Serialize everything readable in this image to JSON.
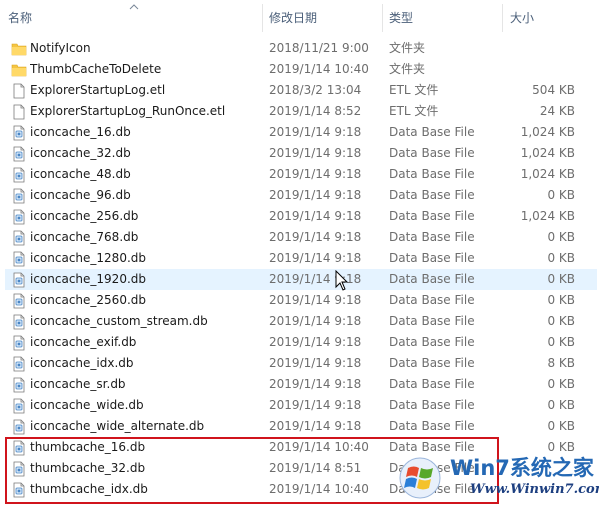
{
  "columns": {
    "name": "名称",
    "date": "修改日期",
    "type": "类型",
    "size": "大小"
  },
  "files": [
    {
      "name": "NotifyIcon",
      "date": "2018/11/21 9:00",
      "type": "文件夹",
      "size": "",
      "icon": "folder-icon"
    },
    {
      "name": "ThumbCacheToDelete",
      "date": "2019/1/14 10:40",
      "type": "文件夹",
      "size": "",
      "icon": "folder-icon"
    },
    {
      "name": "ExplorerStartupLog.etl",
      "date": "2018/3/2 13:04",
      "type": "ETL 文件",
      "size": "504 KB",
      "icon": "file-icon"
    },
    {
      "name": "ExplorerStartupLog_RunOnce.etl",
      "date": "2019/1/14 8:52",
      "type": "ETL 文件",
      "size": "24 KB",
      "icon": "file-icon"
    },
    {
      "name": "iconcache_16.db",
      "date": "2019/1/14 9:18",
      "type": "Data Base File",
      "size": "1,024 KB",
      "icon": "db-file-icon"
    },
    {
      "name": "iconcache_32.db",
      "date": "2019/1/14 9:18",
      "type": "Data Base File",
      "size": "1,024 KB",
      "icon": "db-file-icon"
    },
    {
      "name": "iconcache_48.db",
      "date": "2019/1/14 9:18",
      "type": "Data Base File",
      "size": "1,024 KB",
      "icon": "db-file-icon"
    },
    {
      "name": "iconcache_96.db",
      "date": "2019/1/14 9:18",
      "type": "Data Base File",
      "size": "0 KB",
      "icon": "db-file-icon"
    },
    {
      "name": "iconcache_256.db",
      "date": "2019/1/14 9:18",
      "type": "Data Base File",
      "size": "1,024 KB",
      "icon": "db-file-icon"
    },
    {
      "name": "iconcache_768.db",
      "date": "2019/1/14 9:18",
      "type": "Data Base File",
      "size": "0 KB",
      "icon": "db-file-icon"
    },
    {
      "name": "iconcache_1280.db",
      "date": "2019/1/14 9:18",
      "type": "Data Base File",
      "size": "0 KB",
      "icon": "db-file-icon"
    },
    {
      "name": "iconcache_1920.db",
      "date": "2019/1/14 9:18",
      "type": "Data Base File",
      "size": "0 KB",
      "icon": "db-file-icon"
    },
    {
      "name": "iconcache_2560.db",
      "date": "2019/1/14 9:18",
      "type": "Data Base File",
      "size": "0 KB",
      "icon": "db-file-icon"
    },
    {
      "name": "iconcache_custom_stream.db",
      "date": "2019/1/14 9:18",
      "type": "Data Base File",
      "size": "0 KB",
      "icon": "db-file-icon"
    },
    {
      "name": "iconcache_exif.db",
      "date": "2019/1/14 9:18",
      "type": "Data Base File",
      "size": "0 KB",
      "icon": "db-file-icon"
    },
    {
      "name": "iconcache_idx.db",
      "date": "2019/1/14 9:18",
      "type": "Data Base File",
      "size": "8 KB",
      "icon": "db-file-icon"
    },
    {
      "name": "iconcache_sr.db",
      "date": "2019/1/14 9:18",
      "type": "Data Base File",
      "size": "0 KB",
      "icon": "db-file-icon"
    },
    {
      "name": "iconcache_wide.db",
      "date": "2019/1/14 9:18",
      "type": "Data Base File",
      "size": "0 KB",
      "icon": "db-file-icon"
    },
    {
      "name": "iconcache_wide_alternate.db",
      "date": "2019/1/14 9:18",
      "type": "Data Base File",
      "size": "0 KB",
      "icon": "db-file-icon"
    },
    {
      "name": "thumbcache_16.db",
      "date": "2019/1/14 10:40",
      "type": "Data Base File",
      "size": "0 KB",
      "icon": "db-file-icon"
    },
    {
      "name": "thumbcache_32.db",
      "date": "2019/1/14 8:51",
      "type": "Data Base File",
      "size": "",
      "icon": "db-file-icon"
    },
    {
      "name": "thumbcache_idx.db",
      "date": "2019/1/14 10:40",
      "type": "Data Base File",
      "size": "",
      "icon": "db-file-icon"
    }
  ],
  "hovered_row": "iconcache_1920.db",
  "highlighted_rows": [
    "thumbcache_16.db",
    "thumbcache_32.db",
    "thumbcache_idx.db"
  ],
  "watermark": {
    "brand": "Win7系统之家",
    "url": "Www.Winwin7.com"
  },
  "colors": {
    "header_text": "#4c607a",
    "hover_row": "#e5f3ff",
    "highlight_border": "#d0141c",
    "folder": "#f5c543",
    "watermark_blue": "#2468b4"
  }
}
